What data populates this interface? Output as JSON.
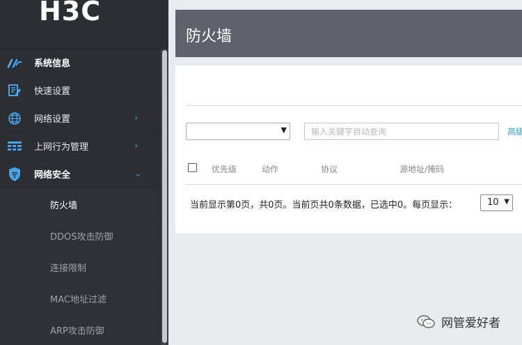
{
  "brand": {
    "logo_text": "H3C"
  },
  "sidebar": {
    "items": [
      {
        "label": "系统信息",
        "icon": "gauge-icon",
        "has_children": false
      },
      {
        "label": "快速设置",
        "icon": "document-edit-icon",
        "has_children": false
      },
      {
        "label": "网络设置",
        "icon": "globe-icon",
        "has_children": true,
        "chevron": "›"
      },
      {
        "label": "上网行为管理",
        "icon": "grid-icon",
        "has_children": true,
        "chevron": "›"
      },
      {
        "label": "网络安全",
        "icon": "shield-wifi-icon",
        "has_children": true,
        "chevron": "⌄",
        "expanded": true
      }
    ],
    "sub_items": [
      {
        "label": "防火墙",
        "active": true
      },
      {
        "label": "DDOS攻击防御",
        "active": false
      },
      {
        "label": "连接限制",
        "active": false
      },
      {
        "label": "MAC地址过滤",
        "active": false
      },
      {
        "label": "ARP攻击防御",
        "active": false
      }
    ]
  },
  "main": {
    "title": "防火墙",
    "filter": {
      "select_value": "",
      "search_placeholder": "输入关键字自动查询",
      "advanced_link": "高级"
    },
    "table": {
      "columns": [
        "优先级",
        "动作",
        "协议",
        "源地址/掩码"
      ]
    },
    "pager": {
      "summary": "当前显示第0页，共0页。当前页共0条数据，已选中0。每页显示：",
      "page_size": "10"
    }
  },
  "watermark": {
    "text": "网管爱好者"
  },
  "colors": {
    "sidebar_bg": "#2b2e33",
    "title_bar": "#5f616c",
    "accent_blue": "#3b8fd8",
    "link": "#2a9fd6"
  }
}
